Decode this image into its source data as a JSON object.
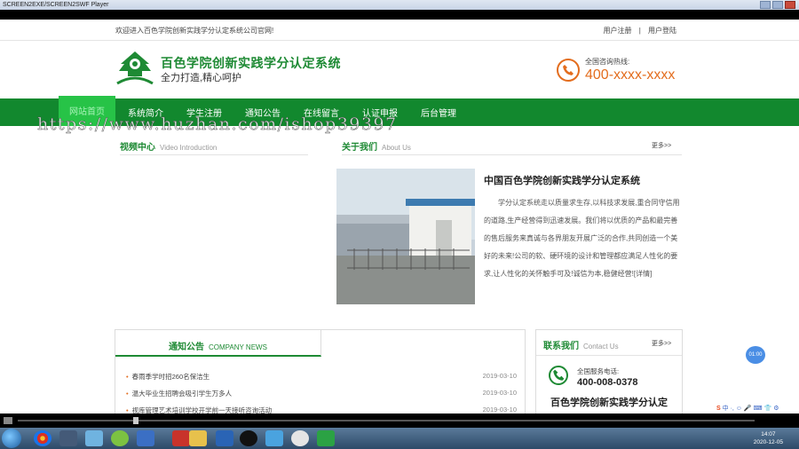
{
  "window": {
    "title": "SCREEN2EXE/SCREEN2SWF Player"
  },
  "topbar": {
    "welcome": "欢迎进入百色学院创新实践学分认定系统公司官网!",
    "register": "用户注册",
    "login": "用户登陆"
  },
  "header": {
    "site_title": "百色学院创新实践学分认定系统",
    "slogan": "全力打造,精心呵护",
    "hotline_label": "全国咨询热线:",
    "hotline": "400-xxxx-xxxx"
  },
  "nav": {
    "items": [
      {
        "label": "网站首页",
        "active": true
      },
      {
        "label": "系统简介"
      },
      {
        "label": "学生注册"
      },
      {
        "label": "通知公告"
      },
      {
        "label": "在线留言"
      },
      {
        "label": "认证申报"
      },
      {
        "label": "后台管理"
      }
    ]
  },
  "watermark": "https://www.huzhan.com/ishop39397",
  "video": {
    "title": "视频中心",
    "title_en": "Video Introduction"
  },
  "about": {
    "title": "关于我们",
    "title_en": "About Us",
    "more": "更多>>",
    "heading": "中国百色学院创新实践学分认定系统",
    "text": "学分认定系统走以质量求生存,以科技求发展,重合同守信用的道路,生产经营得到迅速发展。我们将以优质的产品和最完善的售后服务来真诚与各界朋友开展广泛的合作,共同创造一个美好的未来!公司的软、硬环境的设计和管理都应满足人性化的要求,让人性化的关怀触手可及!诚信为本,稳健经营![详情]"
  },
  "news": {
    "title": "通知公告",
    "title_en": "COMPANY NEWS",
    "rows": [
      {
        "text": "春雨季学时招260名保洁生",
        "date": "2019-03-10"
      },
      {
        "text": "温大毕业生招聘会吸引学生万多人",
        "date": "2019-03-10"
      },
      {
        "text": "视库管理艺术培训学校开学前一天接听咨询活动",
        "date": "2019-03-10"
      }
    ]
  },
  "contact": {
    "title": "联系我们",
    "title_en": "Contact Us",
    "more": "更多>>",
    "tel_label": "全国服务电话:",
    "tel": "400-008-0378",
    "name": "百色学院创新实践学分认定"
  },
  "float_button": "01:00",
  "ime": {
    "text": "中 ·, ☺ 🎤 ⌨ 👕 ⚙"
  },
  "tray": {
    "time": "14:07",
    "date": "2020-12-05"
  },
  "colors": {
    "brand_green": "#12882e",
    "active_tab": "#27c347",
    "accent_orange": "#e36d1e"
  }
}
